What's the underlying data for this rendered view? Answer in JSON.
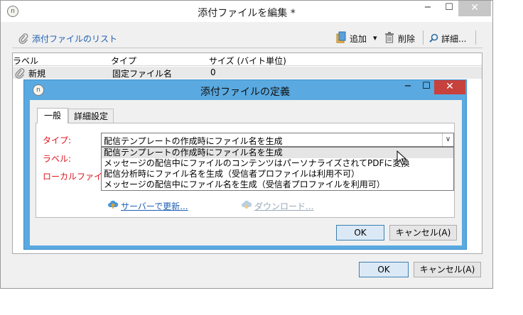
{
  "outer": {
    "title": "添付ファイルを編集 *",
    "app_icon_glyph": "n",
    "minimize_glyph": "−",
    "maximize_glyph": "☐",
    "close_glyph": "✕",
    "toolbar": {
      "list_link": "添付ファイルのリスト",
      "add": "追加",
      "dropdown_glyph": "▾",
      "delete": "削除",
      "detail": "詳細..."
    },
    "list": {
      "columns": [
        "ラベル",
        "タイプ",
        "サイズ (バイト単位)"
      ],
      "rows": [
        {
          "label": "新規",
          "type": "固定ファイル名",
          "size": "0"
        }
      ]
    },
    "ok": "OK",
    "cancel": "キャンセル(A)"
  },
  "dialog": {
    "title": "添付ファイルの定義",
    "minimize_glyph": "−",
    "maximize_glyph": "☐",
    "close_glyph": "✕",
    "tabs": [
      "一般",
      "詳細設定"
    ],
    "fields": {
      "type_label": "タイプ:",
      "label_label": "ラベル:",
      "local_file_label": "ローカルファイル:"
    },
    "type_select": {
      "value": "配信テンプレートの作成時にファイル名を生成",
      "options": [
        "配信テンプレートの作成時にファイル名を生成",
        "メッセージの配信中にファイルのコンテンツはパーソナライズされてPDFに変換",
        "配信分析時にファイル名を生成（受信者プロファイルは利用不可）",
        "メッセージの配信中にファイル名を生成（受信者プロファイルを利用可）"
      ],
      "highlighted_index": 0
    },
    "upload_link": "サーバーで更新...",
    "download_link": "ダウンロード...",
    "ok": "OK",
    "cancel": "キャンセル(A)"
  },
  "colors": {
    "dialog_frame": "#5aa9e0",
    "close_red": "#c7413d",
    "link_blue": "#1f5fb4",
    "required_red": "#e0141e"
  }
}
